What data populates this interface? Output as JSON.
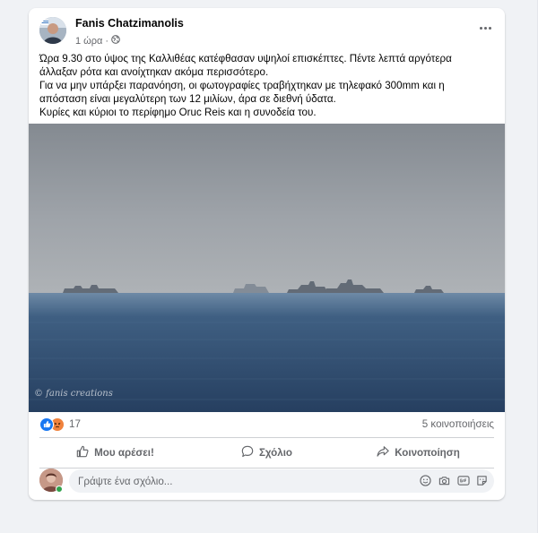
{
  "post": {
    "author": "Fanis Chatzimanolis",
    "time": "1 ώρα",
    "time_separator": "·",
    "text_lines": [
      "Ώρα 9.30 στο ύψος της Καλλιθέας κατέφθασαν υψηλοί επισκέπτες. Πέντε λεπτά αργότερα",
      "άλλαξαν ρότα και ανοίχτηκαν ακόμα περισσότερο.",
      "Για να μην υπάρξει παρανόηση, οι φωτογραφίες τραβήχτηκαν με τηλεφακό 300mm και η",
      "απόσταση είναι μεγαλύτερη των 12 μιλίων, άρα σε διεθνή ύδατα.",
      "Κυρίες και κύριοι το περίφημο Oruc Reis και η συνοδεία του."
    ],
    "photo_watermark": "© fanis creations"
  },
  "stats": {
    "reaction_count": "17",
    "shares": "5 κοινοποιήσεις"
  },
  "actions": {
    "like": "Μου αρέσει!",
    "comment": "Σχόλιο",
    "share": "Κοινοποίηση"
  },
  "comment_box": {
    "placeholder": "Γράψτε ένα σχόλιο..."
  },
  "icons": {
    "privacy": "globe-icon",
    "more": "more-options-icon",
    "like_reaction": "like-reaction-icon",
    "angry_reaction": "angry-reaction-icon",
    "like_action": "thumbs-up-icon",
    "comment_action": "comment-bubble-icon",
    "share_action": "share-arrow-icon",
    "emoji": "emoji-icon",
    "camera": "camera-icon",
    "gif": "gif-icon",
    "sticker": "sticker-icon"
  },
  "colors": {
    "accent": "#1877f2",
    "angry": "#f0823d",
    "online": "#31a24c",
    "secondary_text": "#65676b"
  }
}
